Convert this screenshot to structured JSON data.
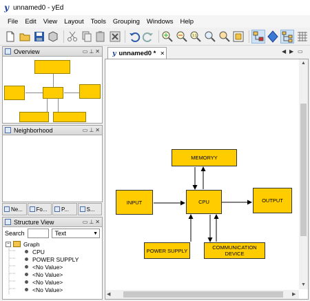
{
  "window": {
    "title": "unnamed0 - yEd",
    "app_icon": "y"
  },
  "menu": [
    "File",
    "Edit",
    "View",
    "Layout",
    "Tools",
    "Grouping",
    "Windows",
    "Help"
  ],
  "toolbar": [
    "new-icon",
    "open-icon",
    "save-icon",
    "save-as-icon",
    "cut-icon",
    "copy-icon",
    "paste-icon",
    "delete-icon",
    "undo-icon",
    "redo-icon",
    "zoom-in-icon",
    "zoom-out-icon",
    "zoom-fit-icon",
    "zoom-icon",
    "zoom-selection-icon",
    "fit-content-icon",
    "edit-mode-icon",
    "navigation-mode-icon",
    "layout-icon",
    "grid-icon"
  ],
  "panels": {
    "overview": {
      "title": "Overview"
    },
    "neighborhood": {
      "title": "Neighborhood"
    },
    "tabs": [
      "Ne...",
      "Fo...",
      "P...",
      "S..."
    ],
    "structure": {
      "title": "Structure View",
      "search_label": "Search",
      "search_value": "",
      "search_type": "Text",
      "tree_root": "Graph",
      "items": [
        "CPU",
        "POWER SUPPLY",
        "<No Value>",
        "<No Value>",
        "<No Value>",
        "<No Value>"
      ]
    }
  },
  "document": {
    "tab_label": "unnamed0 *"
  },
  "graph": {
    "nodes": {
      "memory": "MEMORYY",
      "input": "INPUT",
      "cpu": "CPU",
      "output": "OUTPUT",
      "power": "POWER SUPPLY",
      "comm": "COMMUNICATION DEVICE"
    },
    "node_color": "#ffcc00"
  },
  "colors": {
    "accent": "#1a3f8f",
    "selected_tool": "#cfe3f7"
  }
}
